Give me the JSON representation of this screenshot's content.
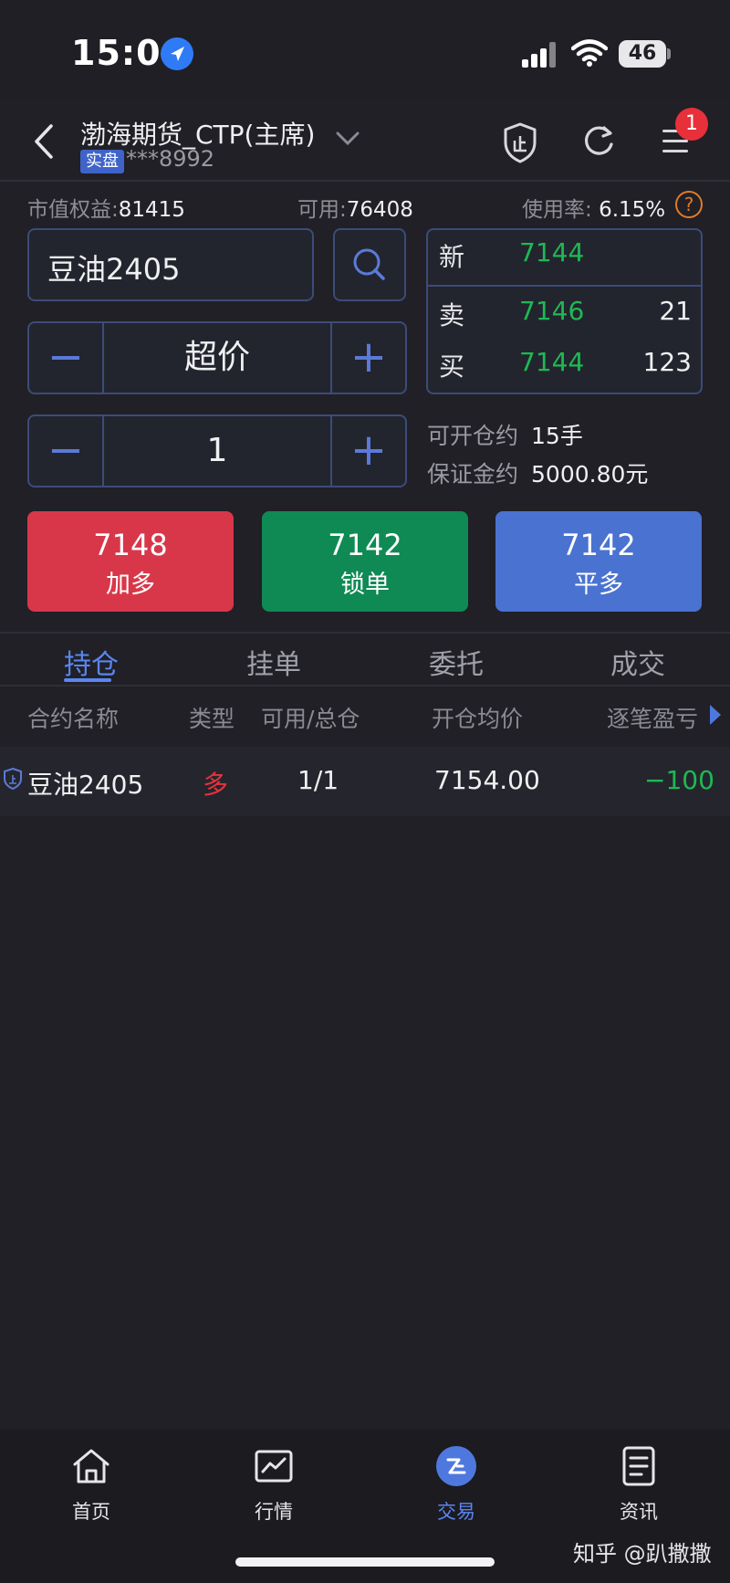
{
  "status_bar": {
    "time": "15:04",
    "battery": "46"
  },
  "header": {
    "title": "渤海期货_CTP(主席)",
    "account_type": "实盘",
    "account_no": "***8992",
    "notification_count": "1"
  },
  "account": {
    "equity_label": "市值权益:",
    "equity_value": "81415",
    "available_label": "可用:",
    "available_value": "76408",
    "usage_label": "使用率:",
    "usage_value": "6.15%",
    "help_glyph": "?"
  },
  "order": {
    "contract": "豆油2405",
    "price_mode": "超价",
    "quantity": "1",
    "minus": "−",
    "plus": "+"
  },
  "quote": {
    "latest_label": "新",
    "latest_price": "7144",
    "ask_label": "卖",
    "ask_price": "7146",
    "ask_volume": "21",
    "bid_label": "买",
    "bid_price": "7144",
    "bid_volume": "123"
  },
  "estimates": {
    "openable_label": "可开仓约",
    "openable_value": "15手",
    "margin_label": "保证金约",
    "margin_value": "5000.80元"
  },
  "actions": [
    {
      "price": "7148",
      "label": "加多",
      "color": "#d8374a"
    },
    {
      "price": "7142",
      "label": "锁单",
      "color": "#0f8a54"
    },
    {
      "price": "7142",
      "label": "平多",
      "color": "#4a72d0"
    }
  ],
  "tabs": [
    "持仓",
    "挂单",
    "委托",
    "成交"
  ],
  "columns": [
    "合约名称",
    "类型",
    "可用/总仓",
    "开仓均价",
    "逐笔盈亏"
  ],
  "positions": [
    {
      "name": "豆油2405",
      "type": "多",
      "avail_total": "1/1",
      "avg_price": "7154.00",
      "pnl": "−100"
    }
  ],
  "bottom_nav": [
    {
      "label": "首页",
      "icon": "home-icon"
    },
    {
      "label": "行情",
      "icon": "chart-icon"
    },
    {
      "label": "交易",
      "icon": "trade-icon"
    },
    {
      "label": "资讯",
      "icon": "news-icon"
    }
  ],
  "watermark": "知乎 @趴撒撒"
}
